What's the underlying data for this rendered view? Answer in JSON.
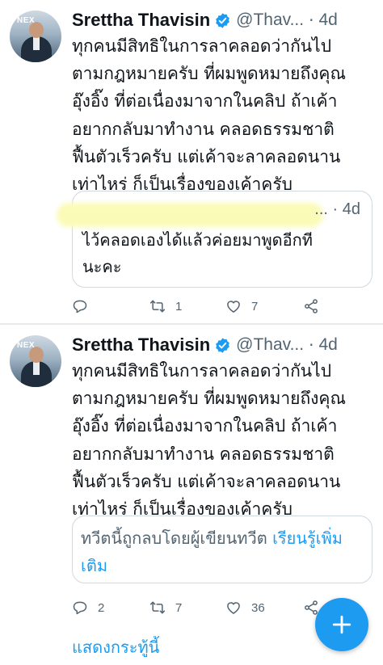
{
  "tweets": [
    {
      "author": {
        "display_name": "Srettha Thavisin",
        "handle": "@Thav...",
        "avatar_logo": "NEX"
      },
      "time": "4d",
      "text": "ทุกคนมีสิทธิในการลาคลอดว่ากันไป\nตามกฎหมายครับ ที่ผมพูดหมายถึงคุณ\nอุ๊งอิ๊ง ที่ต่อเนื่องมาจากในคลิป ถ้าเค้า\nอยากกลับมาทำงาน คลอดธรรมชาติ\nฟื้นตัวเร็วครับ แต่เค้าจะลาคลอดนาน\nเท่าไหร่ ก็เป็นเรื่องของเค้าครับ",
      "quote": {
        "author_suffix": "...",
        "time": "4d",
        "text": "ไว้คลอดเองได้แล้วค่อยมาพูดอีกที\nนะคะ"
      },
      "actions": {
        "replies": "",
        "retweets": "1",
        "likes": "7"
      }
    },
    {
      "author": {
        "display_name": "Srettha Thavisin",
        "handle": "@Thav...",
        "avatar_logo": "NEX"
      },
      "time": "4d",
      "text": "ทุกคนมีสิทธิในการลาคลอดว่ากันไป\nตามกฎหมายครับ ที่ผมพูดหมายถึงคุณ\nอุ๊งอิ๊ง ที่ต่อเนื่องมาจากในคลิป ถ้าเค้า\nอยากกลับมาทำงาน คลอดธรรมชาติ\nฟื้นตัวเร็วครับ แต่เค้าจะลาคลอดนาน\nเท่าไหร่ ก็เป็นเรื่องของเค้าครับ",
      "quote": {
        "deleted_text": "ทวีตนี้ถูกลบโดยผู้เขียนทวีต ",
        "learn_more": "เรียนรู้เพิ่มเติม"
      },
      "actions": {
        "replies": "2",
        "retweets": "7",
        "likes": "36"
      }
    }
  ],
  "show_thread": "แสดงกระทู้นี้",
  "icons": {
    "verified": "verified-badge-icon",
    "reply": "reply-icon",
    "retweet": "retweet-icon",
    "like": "heart-icon",
    "share": "share-icon",
    "compose": "plus-icon"
  },
  "colors": {
    "accent": "#1d9bf0",
    "secondary_text": "#536471",
    "primary_text": "#0f1419",
    "border": "#cfd9de"
  }
}
